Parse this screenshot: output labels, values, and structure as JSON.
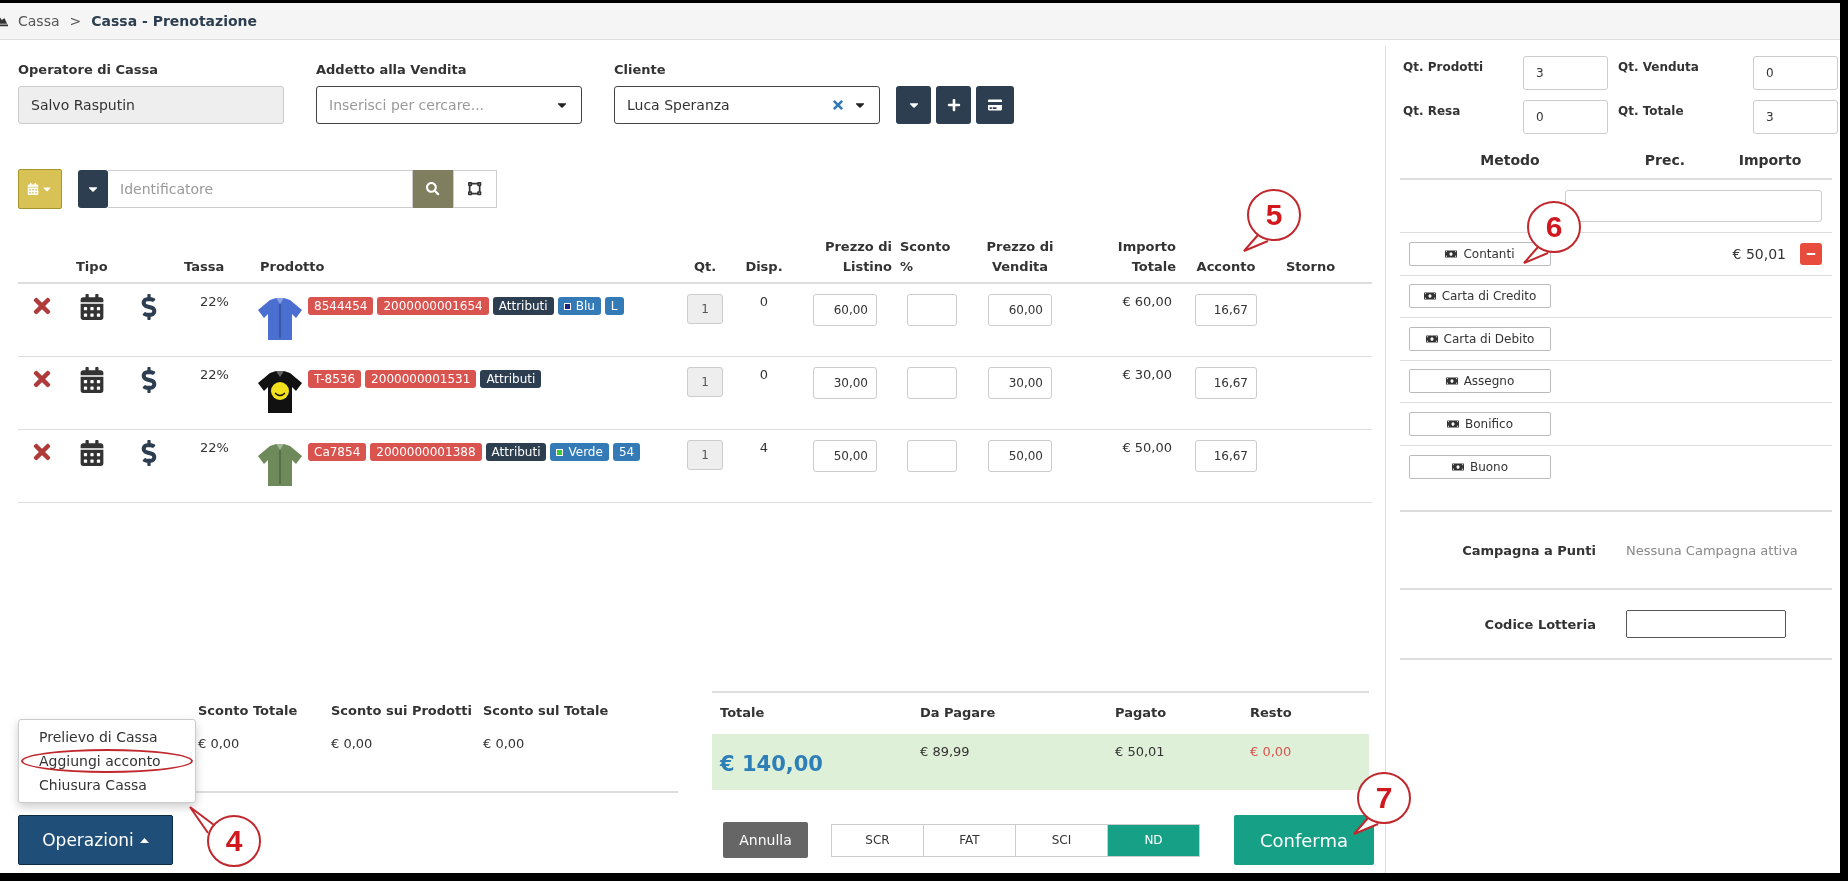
{
  "breadcrumb": {
    "separator": ">",
    "items": [
      {
        "label": "Cassa",
        "current": false
      },
      {
        "label": "Cassa - Prenotazione",
        "current": true
      }
    ]
  },
  "form": {
    "operator": {
      "label": "Operatore di Cassa",
      "value": "Salvo Rasputin",
      "disabled": true
    },
    "seller": {
      "label": "Addetto alla Vendita",
      "placeholder": "Inserisci per cercare..."
    },
    "client": {
      "label": "Cliente",
      "value": "Luca Speranza"
    },
    "client_buttons": [
      {
        "kind": "caret"
      },
      {
        "kind": "plus"
      },
      {
        "kind": "card"
      }
    ]
  },
  "search": {
    "placeholder": "Identificatore"
  },
  "table": {
    "columns": [
      "Tipo",
      "Tassa",
      "Prodotto",
      "Qt.",
      "Disp.",
      "Prezzo di Listino",
      "Sconto %",
      "Prezzo di Vendita",
      "Importo Totale",
      "Acconto",
      "Storno"
    ],
    "rows": [
      {
        "tax": "22%",
        "tags": [
          {
            "kind": "code",
            "text": "8544454"
          },
          {
            "kind": "code",
            "text": "2000000001654"
          },
          {
            "kind": "attr",
            "text": "Attributi"
          },
          {
            "kind": "swatch",
            "text": "Blu",
            "color": "#1a237e"
          },
          {
            "kind": "plain",
            "text": "L"
          }
        ],
        "qty": "1",
        "available": "0",
        "list_price": "60,00",
        "sale_price": "60,00",
        "total": "€ 60,00",
        "deposit": "16,67"
      },
      {
        "tax": "22%",
        "tags": [
          {
            "kind": "code",
            "text": "T-8536"
          },
          {
            "kind": "code",
            "text": "2000000001531"
          },
          {
            "kind": "attr",
            "text": "Attributi"
          }
        ],
        "qty": "1",
        "available": "0",
        "list_price": "30,00",
        "sale_price": "30,00",
        "total": "€ 30,00",
        "deposit": "16,67"
      },
      {
        "tax": "22%",
        "tags": [
          {
            "kind": "code",
            "text": "Ca7854"
          },
          {
            "kind": "code",
            "text": "2000000001388"
          },
          {
            "kind": "attr",
            "text": "Attributi"
          },
          {
            "kind": "swatch",
            "text": "Verde",
            "color": "#33cc33"
          },
          {
            "kind": "plain",
            "text": "54"
          }
        ],
        "qty": "1",
        "available": "4",
        "list_price": "50,00",
        "sale_price": "50,00",
        "total": "€ 50,00",
        "deposit": "16,67"
      }
    ]
  },
  "discounts": [
    {
      "label": "Sconto Totale",
      "value": "€ 0,00"
    },
    {
      "label": "Sconto sui Prodotti",
      "value": "€ 0,00"
    },
    {
      "label": "Sconto sul Totale",
      "value": "€ 0,00"
    }
  ],
  "totals": [
    {
      "label": "Totale",
      "value": "€ 140,00",
      "kind": "grand"
    },
    {
      "label": "Da Pagare",
      "value": "€ 89,99",
      "kind": "plain"
    },
    {
      "label": "Pagato",
      "value": "€ 50,01",
      "kind": "plain"
    },
    {
      "label": "Resto",
      "value": "€ 0,00",
      "kind": "alert"
    }
  ],
  "operations": {
    "label": "Operazioni",
    "expanded": true,
    "menu": [
      {
        "label": "Prelievo di Cassa",
        "circled": false
      },
      {
        "label": "Aggiungi acconto",
        "circled": true
      },
      {
        "label": "Chiusura Cassa",
        "circled": false
      }
    ]
  },
  "cancel": "Annulla",
  "doc_types": [
    {
      "label": "SCR",
      "selected": false
    },
    {
      "label": "FAT",
      "selected": false
    },
    {
      "label": "SCI",
      "selected": false
    },
    {
      "label": "ND",
      "selected": true
    }
  ],
  "confirm": "Conferma",
  "quantities": [
    {
      "label": "Qt. Prodotti",
      "value": "3"
    },
    {
      "label": "Qt. Venduta",
      "value": "0"
    },
    {
      "label": "Qt. Resa",
      "value": "0"
    },
    {
      "label": "Qt. Totale",
      "value": "3"
    }
  ],
  "payments": {
    "columns": [
      "Metodo",
      "Prec.",
      "Importo"
    ],
    "methods": [
      {
        "label": "Contanti",
        "amount": "€ 50,01",
        "removable": true
      },
      {
        "label": "Carta di Credito",
        "removable": false
      },
      {
        "label": "Carta di Debito",
        "removable": false
      },
      {
        "label": "Assegno",
        "removable": false
      },
      {
        "label": "Bonifico",
        "removable": false
      },
      {
        "label": "Buono",
        "removable": false
      }
    ]
  },
  "campaign": {
    "label": "Campagna a Punti",
    "value": "Nessuna Campagna attiva"
  },
  "lottery": {
    "label": "Codice Lotteria"
  },
  "annotations": [
    {
      "label": "5"
    },
    {
      "label": "6"
    },
    {
      "label": "7"
    },
    {
      "label": "4"
    }
  ]
}
